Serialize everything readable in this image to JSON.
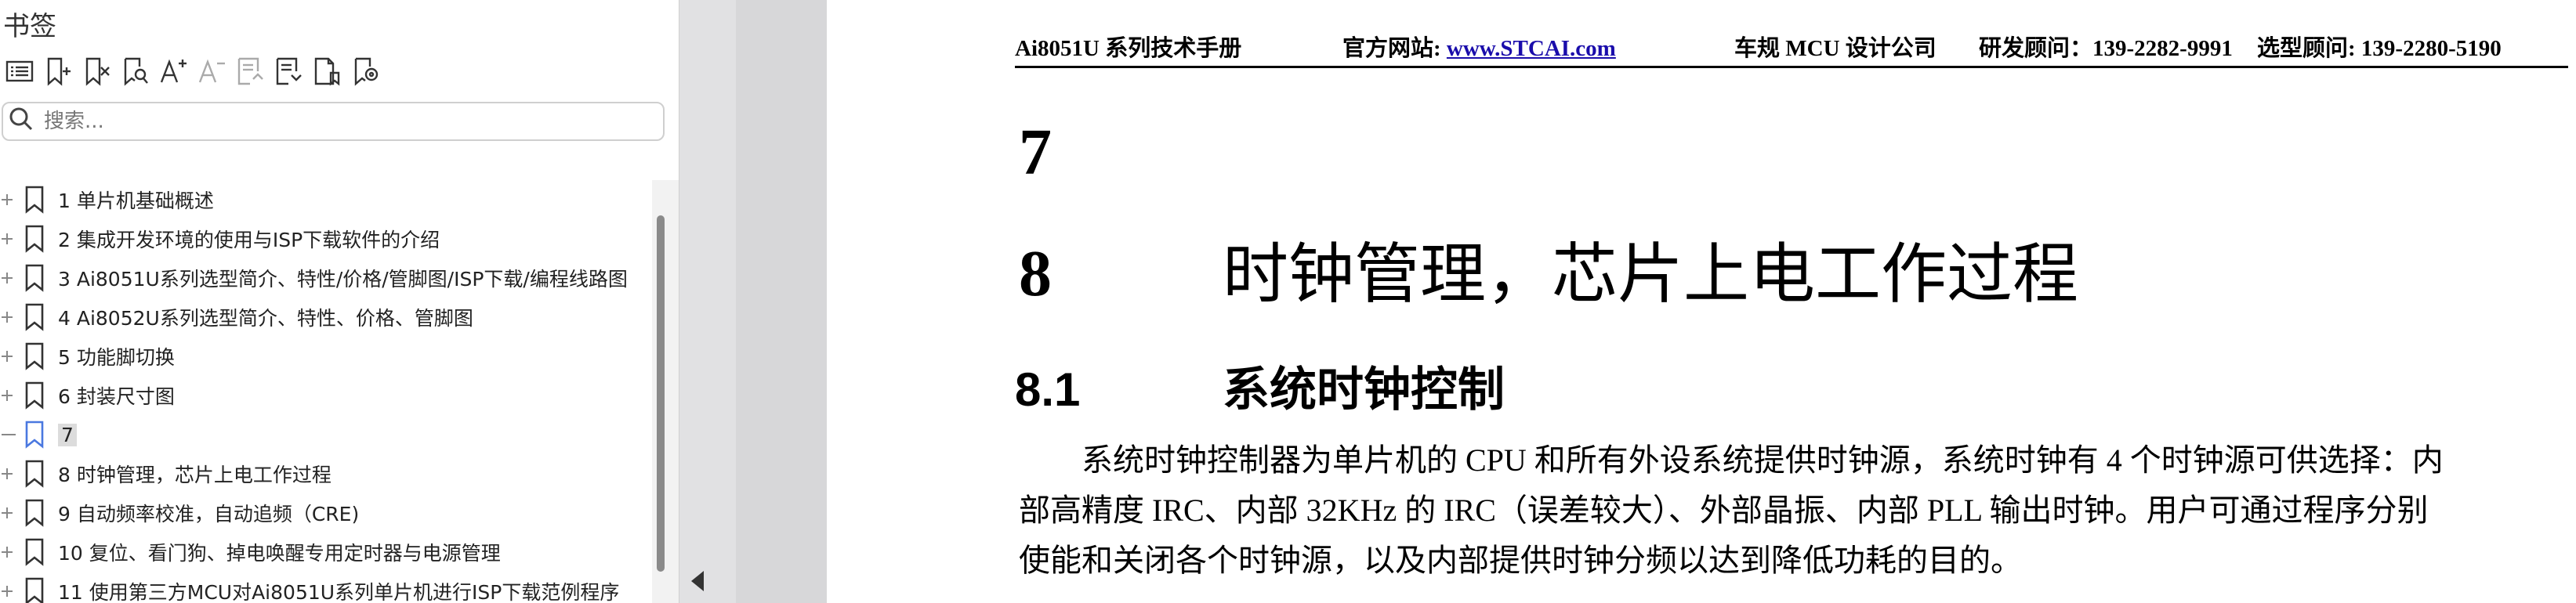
{
  "panel": {
    "title": "书签",
    "toolbar": [
      {
        "icon": "list-icon",
        "enabled": true
      },
      {
        "icon": "add-bookmark-icon",
        "enabled": true
      },
      {
        "icon": "delete-bookmark-icon",
        "enabled": true
      },
      {
        "icon": "find-bookmark-icon",
        "enabled": true
      },
      {
        "icon": "increase-font-icon",
        "enabled": true
      },
      {
        "icon": "decrease-font-icon",
        "enabled": false
      },
      {
        "icon": "collapse-all-icon",
        "enabled": false
      },
      {
        "icon": "expand-all-icon",
        "enabled": true
      },
      {
        "icon": "document-bookmark-icon",
        "enabled": true
      },
      {
        "icon": "locate-bookmark-icon",
        "enabled": true
      }
    ],
    "search_placeholder": "搜索...",
    "items": [
      {
        "label": "1 单片机基础概述",
        "expandable": true,
        "selected": false
      },
      {
        "label": "2  集成开发环境的使用与ISP下载软件的介绍",
        "expandable": true,
        "selected": false
      },
      {
        "label": "3  Ai8051U系列选型简介、特性/价格/管脚图/ISP下载/编程线路图",
        "expandable": true,
        "selected": false
      },
      {
        "label": "4  Ai8052U系列选型简介、特性、价格、管脚图",
        "expandable": true,
        "selected": false
      },
      {
        "label": "5  功能脚切换",
        "expandable": true,
        "selected": false
      },
      {
        "label": "6  封装尺寸图",
        "expandable": true,
        "selected": false
      },
      {
        "label": "7",
        "expandable": false,
        "selected": true
      },
      {
        "label": "8 时钟管理，芯片上电工作过程",
        "expandable": true,
        "selected": false
      },
      {
        "label": "9  自动频率校准，自动追频（CRE)",
        "expandable": true,
        "selected": false
      },
      {
        "label": "10  复位、看门狗、掉电唤醒专用定时器与电源管理",
        "expandable": true,
        "selected": false
      },
      {
        "label": "11  使用第三方MCU对Ai8051U系列单片机进行ISP下载范例程序",
        "expandable": true,
        "selected": false
      }
    ]
  },
  "document": {
    "header": {
      "manual": "Ai8051U 系列技术手册",
      "site_label": "官方网站: ",
      "site_link": "www.STCAI.com",
      "company": "车规 MCU 设计公司",
      "rd_contact": "研发顾问：139-2282-9991",
      "sel_contact": "选型顾问: 139-2280-5190"
    },
    "heading_7": "7",
    "heading_8_num": "8",
    "heading_8_title": "时钟管理，芯片上电工作过程",
    "heading_81_num": "8.1",
    "heading_81_title": "系统时钟控制",
    "paragraph_lines": [
      "　　系统时钟控制器为单片机的 CPU 和所有外设系统提供时钟源，系统时钟有 4 个时钟源可供选择：内",
      "部高精度 IRC、内部 32KHz 的 IRC（误差较大）、外部晶振、内部 PLL 输出时钟。用户可通过程序分别",
      "使能和关闭各个时钟源，以及内部提供时钟分频以达到降低功耗的目的。"
    ]
  }
}
